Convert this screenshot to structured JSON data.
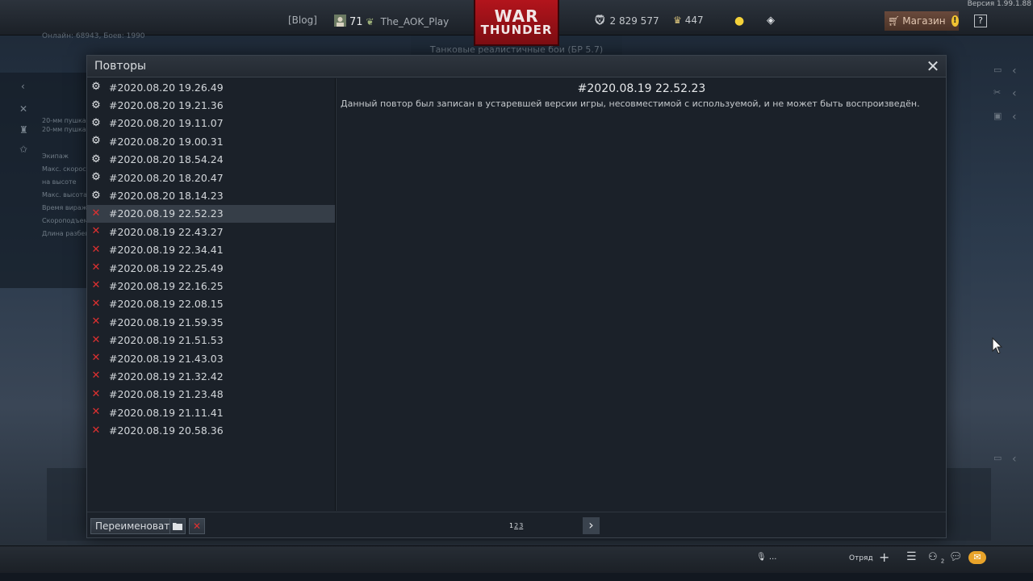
{
  "topbar": {
    "version": "Версия 1.99.1.88",
    "blog": "[Blog]",
    "level": "71",
    "nickname": "The_AOK_Play",
    "logo_line1": "WAR",
    "logo_line2": "THUNDER",
    "silver_lions": "2 829 577",
    "golden_eagles": "447",
    "shop_label": "Магазин",
    "help": "?"
  },
  "background": {
    "online": "Онлайн: 68943, Боев: 1990",
    "banner": "Танковые реалистичные бои (БР 5.7)",
    "labels": [
      "20-мм пушка",
      "20-мм пушка",
      "Экипаж",
      "Макс. скорость",
      "на высоте",
      "Макс. высота",
      "Время виража",
      "Скороподъем.",
      "Длина разбега"
    ]
  },
  "dialog": {
    "title": "Повторы",
    "close": "✕",
    "replays": [
      {
        "name": "#2020.08.20 19.26.49",
        "status": "ok"
      },
      {
        "name": "#2020.08.20 19.21.36",
        "status": "ok"
      },
      {
        "name": "#2020.08.20 19.11.07",
        "status": "ok"
      },
      {
        "name": "#2020.08.20 19.00.31",
        "status": "ok"
      },
      {
        "name": "#2020.08.20 18.54.24",
        "status": "ok"
      },
      {
        "name": "#2020.08.20 18.20.47",
        "status": "ok"
      },
      {
        "name": "#2020.08.20 18.14.23",
        "status": "ok"
      },
      {
        "name": "#2020.08.19 22.52.23",
        "status": "incompatible"
      },
      {
        "name": "#2020.08.19 22.43.27",
        "status": "incompatible"
      },
      {
        "name": "#2020.08.19 22.34.41",
        "status": "incompatible"
      },
      {
        "name": "#2020.08.19 22.25.49",
        "status": "incompatible"
      },
      {
        "name": "#2020.08.19 22.16.25",
        "status": "incompatible"
      },
      {
        "name": "#2020.08.19 22.08.15",
        "status": "incompatible"
      },
      {
        "name": "#2020.08.19 21.59.35",
        "status": "incompatible"
      },
      {
        "name": "#2020.08.19 21.51.53",
        "status": "incompatible"
      },
      {
        "name": "#2020.08.19 21.43.03",
        "status": "incompatible"
      },
      {
        "name": "#2020.08.19 21.32.42",
        "status": "incompatible"
      },
      {
        "name": "#2020.08.19 21.23.48",
        "status": "incompatible"
      },
      {
        "name": "#2020.08.19 21.11.41",
        "status": "incompatible"
      },
      {
        "name": "#2020.08.19 20.58.36",
        "status": "incompatible"
      }
    ],
    "selected_index": 7,
    "detail": {
      "title": "#2020.08.19 22.52.23",
      "message": "Данный повтор был записан в устаревшей версии игры, несовместимой с используемой, и не может быть воспроизведён."
    },
    "footer": {
      "rename_label": "Переименовать",
      "pages": [
        "1",
        "2",
        "3"
      ],
      "current_page": "1"
    }
  },
  "bottombar": {
    "mic": "...",
    "squad": "Отряд",
    "friends_count": "2"
  },
  "icons": {
    "ok": "gear-icon",
    "incompatible": "error-x-icon"
  },
  "colors": {
    "error": "#e03030",
    "selected_row": "#363e48",
    "logo_red": "#b3141c",
    "mail": "#e8a32a"
  }
}
